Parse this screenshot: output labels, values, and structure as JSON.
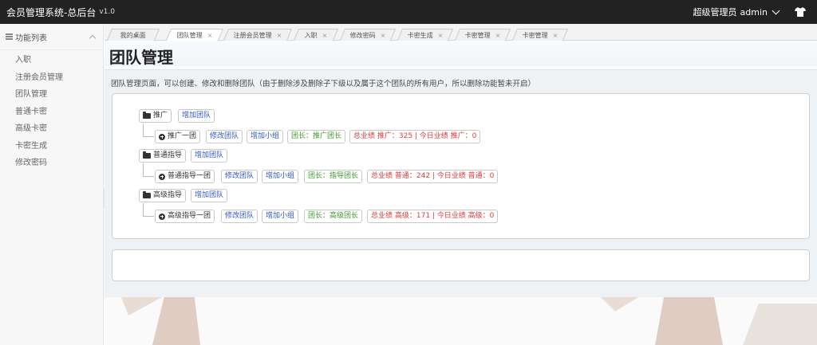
{
  "app": {
    "title": "会员管理系统-总后台",
    "version": "v1.0"
  },
  "header": {
    "user_role": "超级管理员",
    "username": "admin"
  },
  "sidebar": {
    "heading": "功能列表",
    "items": [
      "入职",
      "注册会员管理",
      "团队管理",
      "普通卡密",
      "高级卡密",
      "卡密生成",
      "修改密码"
    ]
  },
  "tabs": [
    {
      "label": "我的桌面",
      "closable": false
    },
    {
      "label": "团队管理",
      "closable": true
    },
    {
      "label": "注册会员管理",
      "closable": true
    },
    {
      "label": "入职",
      "closable": true
    },
    {
      "label": "修改密码",
      "closable": true
    },
    {
      "label": "卡密生成",
      "closable": true
    },
    {
      "label": "卡密管理",
      "closable": true
    },
    {
      "label": "卡密管理",
      "closable": true
    }
  ],
  "page": {
    "title": "团队管理",
    "description": "团队管理页面，可以创建、修改和删除团队（由于删除涉及删除子下级以及属于这个团队的所有用户，所以删除功能暂未开启）"
  },
  "teams": [
    {
      "group": "推广",
      "add_team": "增加团队",
      "sub": {
        "name": "推广一团",
        "edit": "修改团队",
        "add_group": "增加小组",
        "leader": "团长：推广团长",
        "stats": "总业绩 推广：325 | 今日业绩 推广：0"
      }
    },
    {
      "group": "普通指导",
      "add_team": "增加团队",
      "sub": {
        "name": "普通指导一团",
        "edit": "修改团队",
        "add_group": "增加小组",
        "leader": "团长：指导团长",
        "stats": "总业绩 普通：242 | 今日业绩 普通：0"
      }
    },
    {
      "group": "高级指导",
      "add_team": "增加团队",
      "sub": {
        "name": "高级指导一团",
        "edit": "修改团队",
        "add_group": "增加小组",
        "leader": "团长：高级团长",
        "stats": "总业绩 高级：171 | 今日业绩 高级：0"
      }
    }
  ],
  "colors": {
    "topbar": "#222222",
    "blue_link": "#2b57c5",
    "green_text": "#3a9a2a",
    "red_text": "#e03a3a"
  }
}
